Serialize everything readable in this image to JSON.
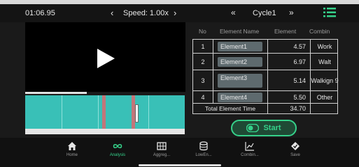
{
  "header": {
    "time": "01:06.95",
    "speed_label": "Speed: 1.00x",
    "cycle_label": "Cycle1",
    "speed_prev_icon": "chevron-left-icon",
    "speed_next_icon": "chevron-right-icon",
    "cycle_prev_icon": "double-chevron-left-icon",
    "cycle_next_icon": "double-chevron-right-icon",
    "menu_icon": "list-icon",
    "accent": "#35d18a"
  },
  "player": {
    "play_icon": "play-icon",
    "progress": 0.38
  },
  "table": {
    "headers": [
      "No",
      "Element Name",
      "Element",
      "Combin"
    ],
    "rows": [
      {
        "no": "1",
        "name": "Element1",
        "value": "4.57",
        "combin": "Work"
      },
      {
        "no": "2",
        "name": "Element2",
        "value": "6.97",
        "combin": "Walt"
      },
      {
        "no": "3",
        "name": "Element3",
        "value": "5.14",
        "combin": "Walkign 9"
      },
      {
        "no": "4",
        "name": "Element4",
        "value": "5.50",
        "combin": "Other"
      }
    ],
    "total_label": "Total Element Time",
    "total_value": "34.70"
  },
  "start_button": {
    "label": "Start",
    "icon": "toggle-icon"
  },
  "nav": [
    {
      "label": "Home",
      "icon": "home-icon"
    },
    {
      "label": "Analysis",
      "icon": "infinity-icon",
      "active": true
    },
    {
      "label": "Aggreg...",
      "icon": "grid-icon"
    },
    {
      "label": "LowEn...",
      "icon": "database-icon"
    },
    {
      "label": "Combin...",
      "icon": "chart-icon"
    },
    {
      "label": "Save",
      "icon": "save-icon"
    }
  ],
  "colors": {
    "timeline": "#39c0b7",
    "marker": "#c2767a",
    "background": "#1a1a1a"
  }
}
